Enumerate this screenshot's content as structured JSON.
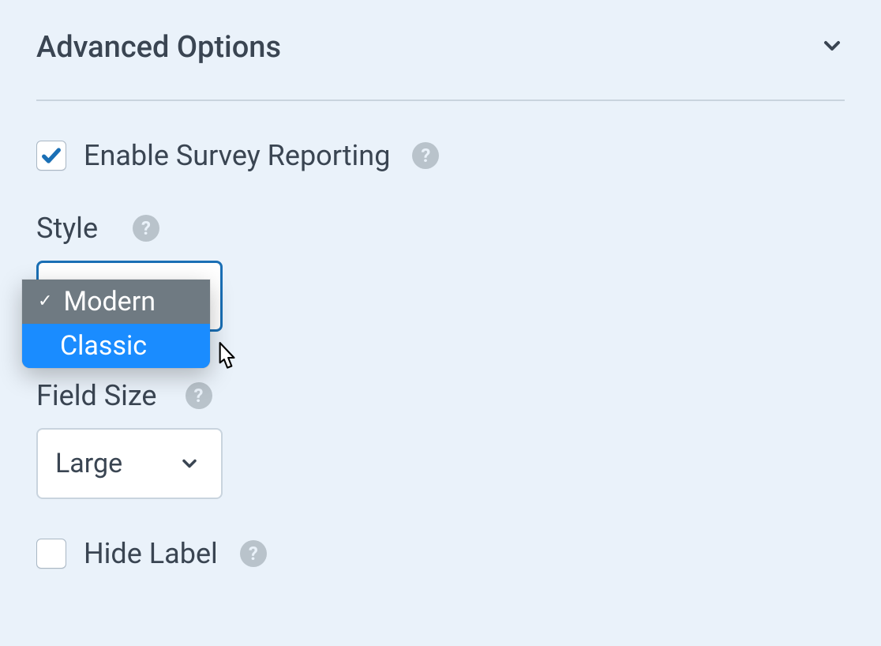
{
  "section": {
    "title": "Advanced Options"
  },
  "survey": {
    "label": "Enable Survey Reporting",
    "checked": true
  },
  "style": {
    "label": "Style",
    "selected": "Modern",
    "options": [
      "Modern",
      "Classic"
    ],
    "highlighted": "Classic"
  },
  "fieldSize": {
    "label": "Field Size",
    "value": "Large"
  },
  "hideLabel": {
    "label": "Hide Label",
    "checked": false
  }
}
